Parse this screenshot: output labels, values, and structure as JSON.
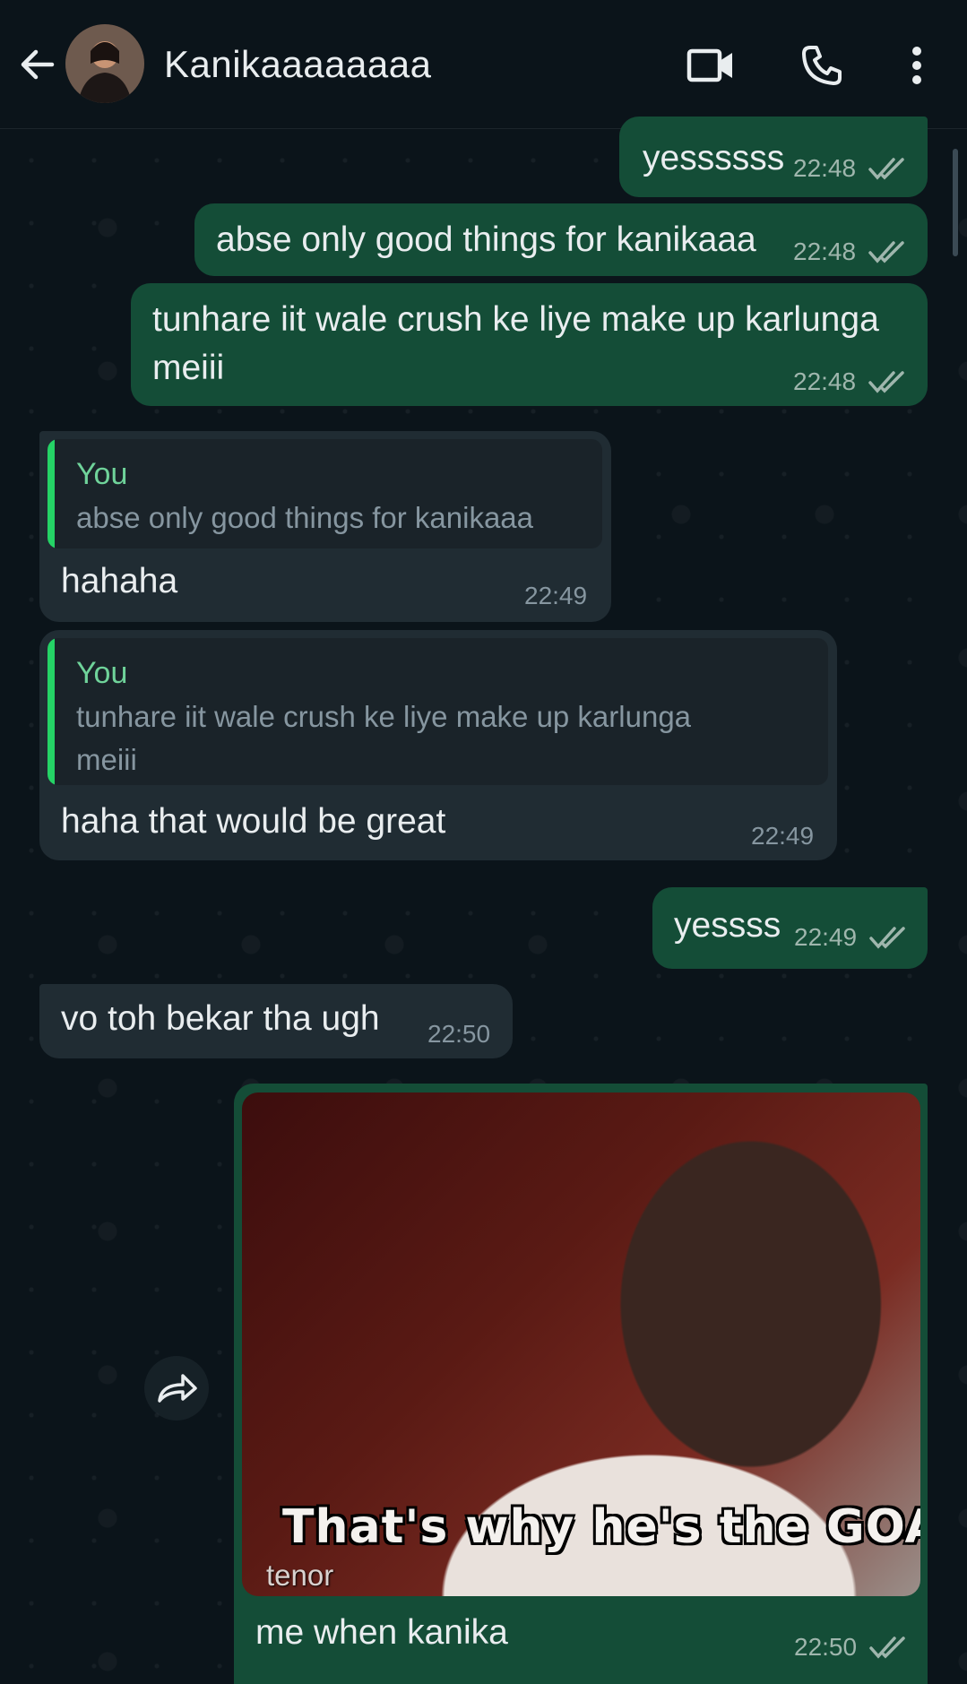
{
  "header": {
    "contact_name": "Kanikaaaaaaaa",
    "back_icon": "arrow-left-icon",
    "avatar": "contact-avatar",
    "video_icon": "video-call-icon",
    "call_icon": "phone-icon",
    "menu_icon": "more-vertical-icon"
  },
  "colors": {
    "outgoing": "#144d37",
    "incoming": "#202c33",
    "accent": "#25d366",
    "background": "#0b141a"
  },
  "messages": [
    {
      "dir": "out",
      "text": "yessssss",
      "time": "22:48",
      "status": "read"
    },
    {
      "dir": "out",
      "text": "abse only good things for kanikaaa",
      "time": "22:48",
      "status": "read"
    },
    {
      "dir": "out",
      "text_line1": "tunhare iit wale crush ke liye make up karlunga",
      "text_line2": "meiii",
      "time": "22:48",
      "status": "read"
    },
    {
      "dir": "in",
      "quote_author": "You",
      "quote_text": "abse only good things for kanikaaa",
      "text": "hahaha",
      "time": "22:49"
    },
    {
      "dir": "in",
      "quote_author": "You",
      "quote_line1": "tunhare iit wale crush ke liye make up karlunga",
      "quote_line2": "meiii",
      "text": "haha that would be great",
      "time": "22:49"
    },
    {
      "dir": "out",
      "text": "yessss",
      "time": "22:49",
      "status": "read"
    },
    {
      "dir": "in",
      "text": "vo toh bekar tha ugh",
      "time": "22:50"
    },
    {
      "dir": "out",
      "gif_caption": "That's why he's the GOAT",
      "gif_watermark": "tenor",
      "text": "me when kanika",
      "time": "22:50",
      "status": "read",
      "forward_icon": "forward-icon"
    }
  ]
}
